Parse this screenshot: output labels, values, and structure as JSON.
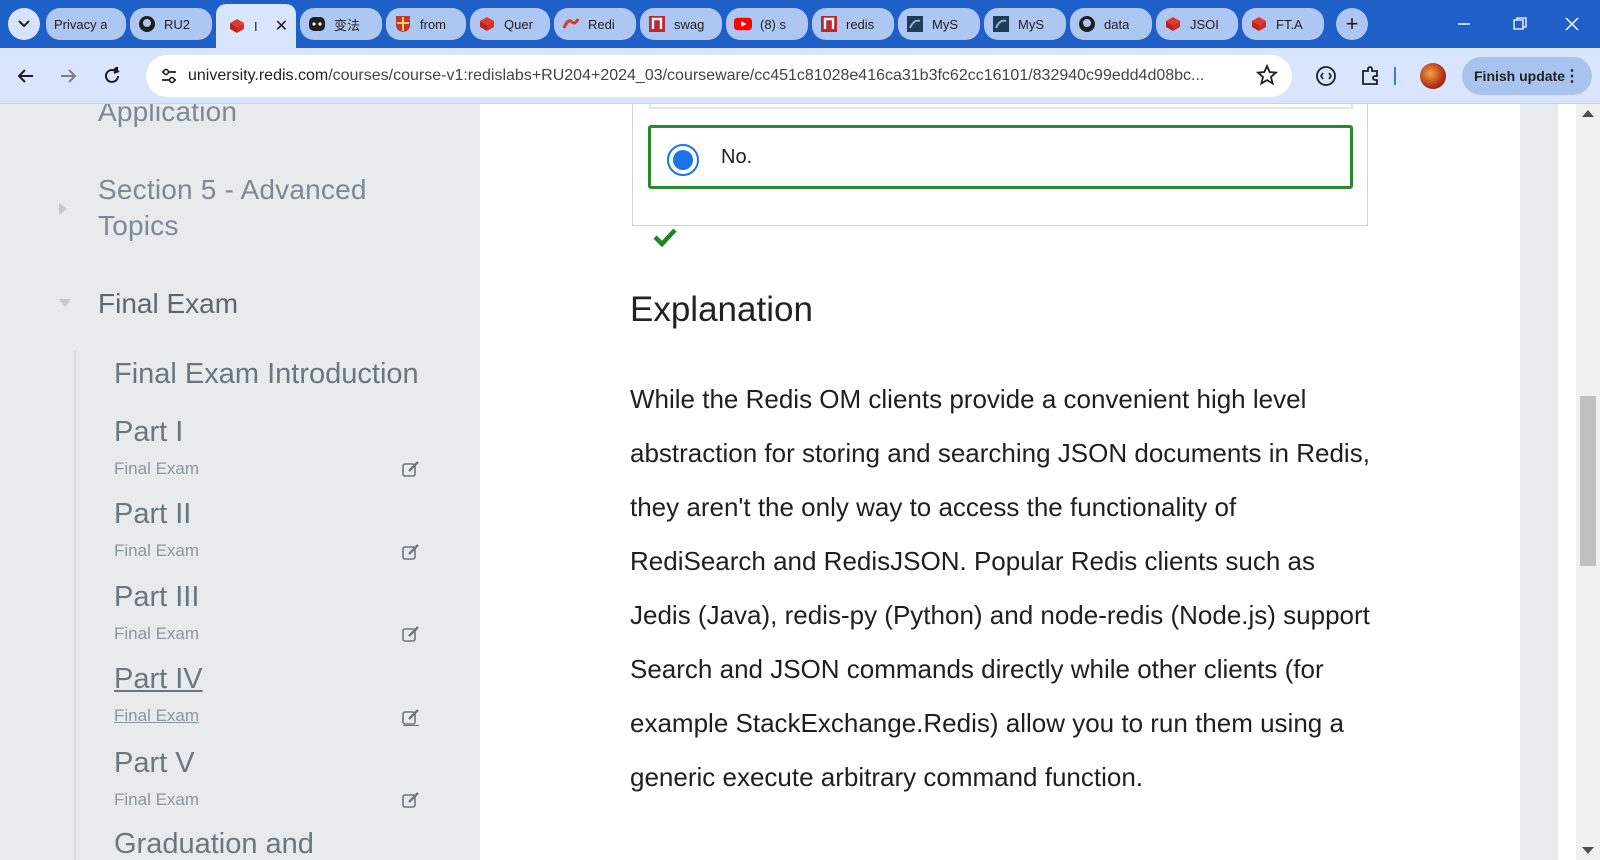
{
  "browser": {
    "tabs": [
      {
        "label": "Privacy a",
        "icon": "privacy-icon"
      },
      {
        "label": "RU2",
        "icon": "github-icon"
      },
      {
        "label": "I",
        "icon": "redis-cube-icon",
        "active": true
      },
      {
        "label": "变法",
        "icon": "chat-bot-icon"
      },
      {
        "label": "from",
        "icon": "university-crest-icon"
      },
      {
        "label": "Quer",
        "icon": "redis-cube-icon"
      },
      {
        "label": "Redi",
        "icon": "redis-logo-icon"
      },
      {
        "label": "swag",
        "icon": "redis-n-icon"
      },
      {
        "label": "(8) s",
        "icon": "youtube-icon"
      },
      {
        "label": "redis",
        "icon": "redis-n-icon"
      },
      {
        "label": "MyS",
        "icon": "mysql-icon"
      },
      {
        "label": "MyS",
        "icon": "mysql-icon"
      },
      {
        "label": "data",
        "icon": "github-icon"
      },
      {
        "label": "JSOI",
        "icon": "redis-cube-icon"
      },
      {
        "label": "FT.A",
        "icon": "redis-cube-icon"
      }
    ],
    "url_host": "university.redis.com",
    "url_path": "/courses/course-v1:redislabs+RU204+2024_03/courseware/cc451c81028e416ca31b3fc62cc16101/832940c99edd4d08bc...",
    "finish_update_label": "Finish update"
  },
  "sidebar": {
    "top_partial": "Application",
    "section5": "Section 5 - Advanced Topics",
    "final_exam": "Final Exam",
    "items": [
      {
        "title": "Final Exam Introduction",
        "subtitle": ""
      },
      {
        "title": "Part I",
        "subtitle": "Final Exam"
      },
      {
        "title": "Part II",
        "subtitle": "Final Exam"
      },
      {
        "title": "Part III",
        "subtitle": "Final Exam"
      },
      {
        "title": "Part IV",
        "subtitle": "Final Exam"
      },
      {
        "title": "Part V",
        "subtitle": "Final Exam"
      }
    ],
    "bottom_partial": "Graduation and"
  },
  "main": {
    "selected_option": "No.",
    "explanation_heading": "Explanation",
    "explanation_text": "While the Redis OM clients provide a convenient high level abstraction for storing and searching JSON documents in Redis, they aren't the only way to access the functionality of RediSearch and RedisJSON. Popular Redis clients such as Jedis (Java), redis-py (Python) and node-redis (Node.js) support Search and JSON commands directly while other clients (for example StackExchange.Redis) allow you to run them using a generic execute arbitrary command function."
  },
  "colors": {
    "tabstrip": "#1f5fc8",
    "toolbar": "#d8e5fc",
    "sidebar_bg": "#e7ebee",
    "correct_green": "#2b8a2b",
    "radio_blue": "#1a73e8"
  }
}
